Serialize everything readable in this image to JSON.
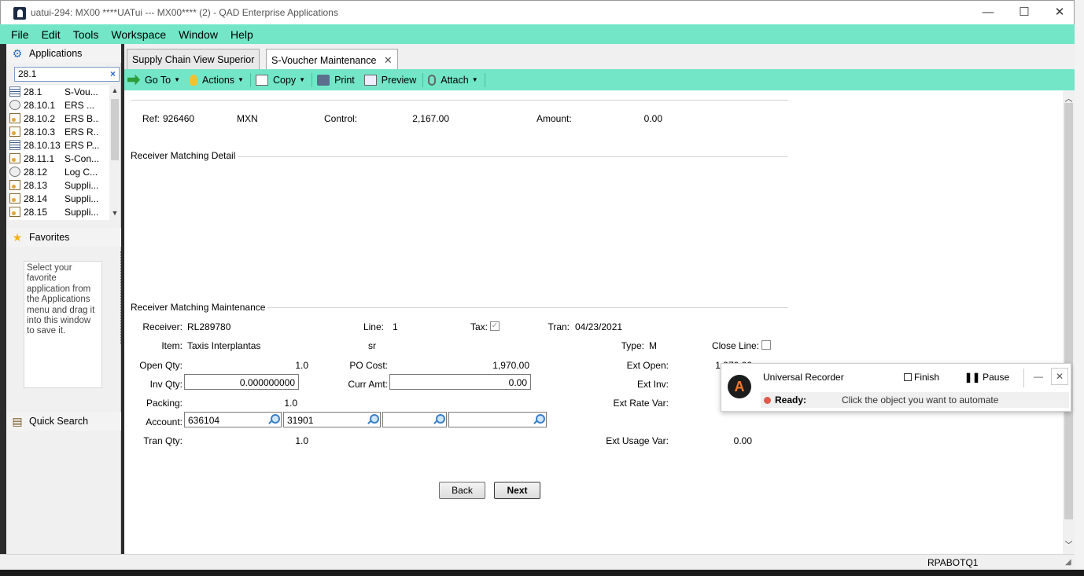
{
  "window": {
    "title": "uatui-294: MX00 ****UATui --- MX00**** (2) - QAD Enterprise Applications",
    "minimize": "—",
    "maximize": "☐",
    "close": "✕"
  },
  "menu": [
    "File",
    "Edit",
    "Tools",
    "Workspace",
    "Window",
    "Help"
  ],
  "sidebar": {
    "applications_label": "Applications",
    "search_value": "28.1",
    "search_clear": "×",
    "items": [
      {
        "code": "28.1",
        "label": "S-Vou...",
        "icon": "grid"
      },
      {
        "code": "28.10.1",
        "label": "ERS ...",
        "icon": "gear"
      },
      {
        "code": "28.10.2",
        "label": "ERS B...",
        "icon": "doc"
      },
      {
        "code": "28.10.3",
        "label": "ERS R...",
        "icon": "doc"
      },
      {
        "code": "28.10.13",
        "label": "ERS P...",
        "icon": "grid"
      },
      {
        "code": "28.11.1",
        "label": "S-Con...",
        "icon": "doc"
      },
      {
        "code": "28.12",
        "label": "Log C...",
        "icon": "gear"
      },
      {
        "code": "28.13",
        "label": "Suppli...",
        "icon": "doc"
      },
      {
        "code": "28.14",
        "label": "Suppli...",
        "icon": "doc"
      },
      {
        "code": "28.15",
        "label": "Suppli...",
        "icon": "doc"
      }
    ],
    "favorites_label": "Favorites",
    "favorites_hint": "Select your favorite application from the Applications menu and drag it into this window to save it.",
    "quick_search_label": "Quick Search"
  },
  "tabs": [
    {
      "label": "Supply Chain View Superior",
      "active": false
    },
    {
      "label": "S-Voucher Maintenance",
      "active": true,
      "close": "✕"
    }
  ],
  "toolbar": {
    "goto": "Go To",
    "actions": "Actions",
    "copy": "Copy",
    "print": "Print",
    "preview": "Preview",
    "attach": "Attach"
  },
  "header": {
    "ref_label": "Ref:",
    "ref_value": "926460",
    "currency": "MXN",
    "control_label": "Control:",
    "control_value": "2,167.00",
    "amount_label": "Amount:",
    "amount_value": "0.00"
  },
  "detail_section": "Receiver Matching Detail",
  "maint_section": "Receiver Matching Maintenance",
  "form": {
    "receiver_label": "Receiver:",
    "receiver_value": "RL289780",
    "line_label": "Line:",
    "line_value": "1",
    "tax_label": "Tax:",
    "tax_checked": "✓",
    "tran_label": "Tran:",
    "tran_value": "04/23/2021",
    "item_label": "Item:",
    "item_value": "Taxis Interplantas",
    "um_value": "sr",
    "type_label": "Type:",
    "type_value": "M",
    "close_line_label": "Close Line:",
    "open_qty_label": "Open Qty:",
    "open_qty_value": "1.0",
    "po_cost_label": "PO Cost:",
    "po_cost_value": "1,970.00",
    "ext_open_label": "Ext Open:",
    "ext_open_value": "1,970.00",
    "inv_qty_label": "Inv Qty:",
    "inv_qty_value": "0.000000000",
    "curr_amt_label": "Curr Amt:",
    "curr_amt_value": "0.00",
    "ext_inv_label": "Ext Inv:",
    "packing_label": "Packing:",
    "packing_value": "1.0",
    "ext_rate_var_label": "Ext Rate Var:",
    "account_label": "Account:",
    "account_value": "636104",
    "sub_account_value": "31901",
    "cost_center_value": "",
    "project_value": "",
    "tran_qty_label": "Tran Qty:",
    "tran_qty_value": "1.0",
    "ext_usage_var_label": "Ext Usage Var:",
    "ext_usage_var_value": "0.00"
  },
  "buttons": {
    "back": "Back",
    "next": "Next"
  },
  "recorder": {
    "title": "Universal Recorder",
    "finish": "Finish",
    "pause": "Pause",
    "minimize": "—",
    "close": "✕",
    "status": "Ready:",
    "message": "Click the object you want to automate",
    "logo": "A"
  },
  "status_bar": {
    "user": "RPABOTQ1"
  },
  "colors": {
    "accent": "#72e6c7",
    "recorder_dot": "#e05a4f"
  }
}
